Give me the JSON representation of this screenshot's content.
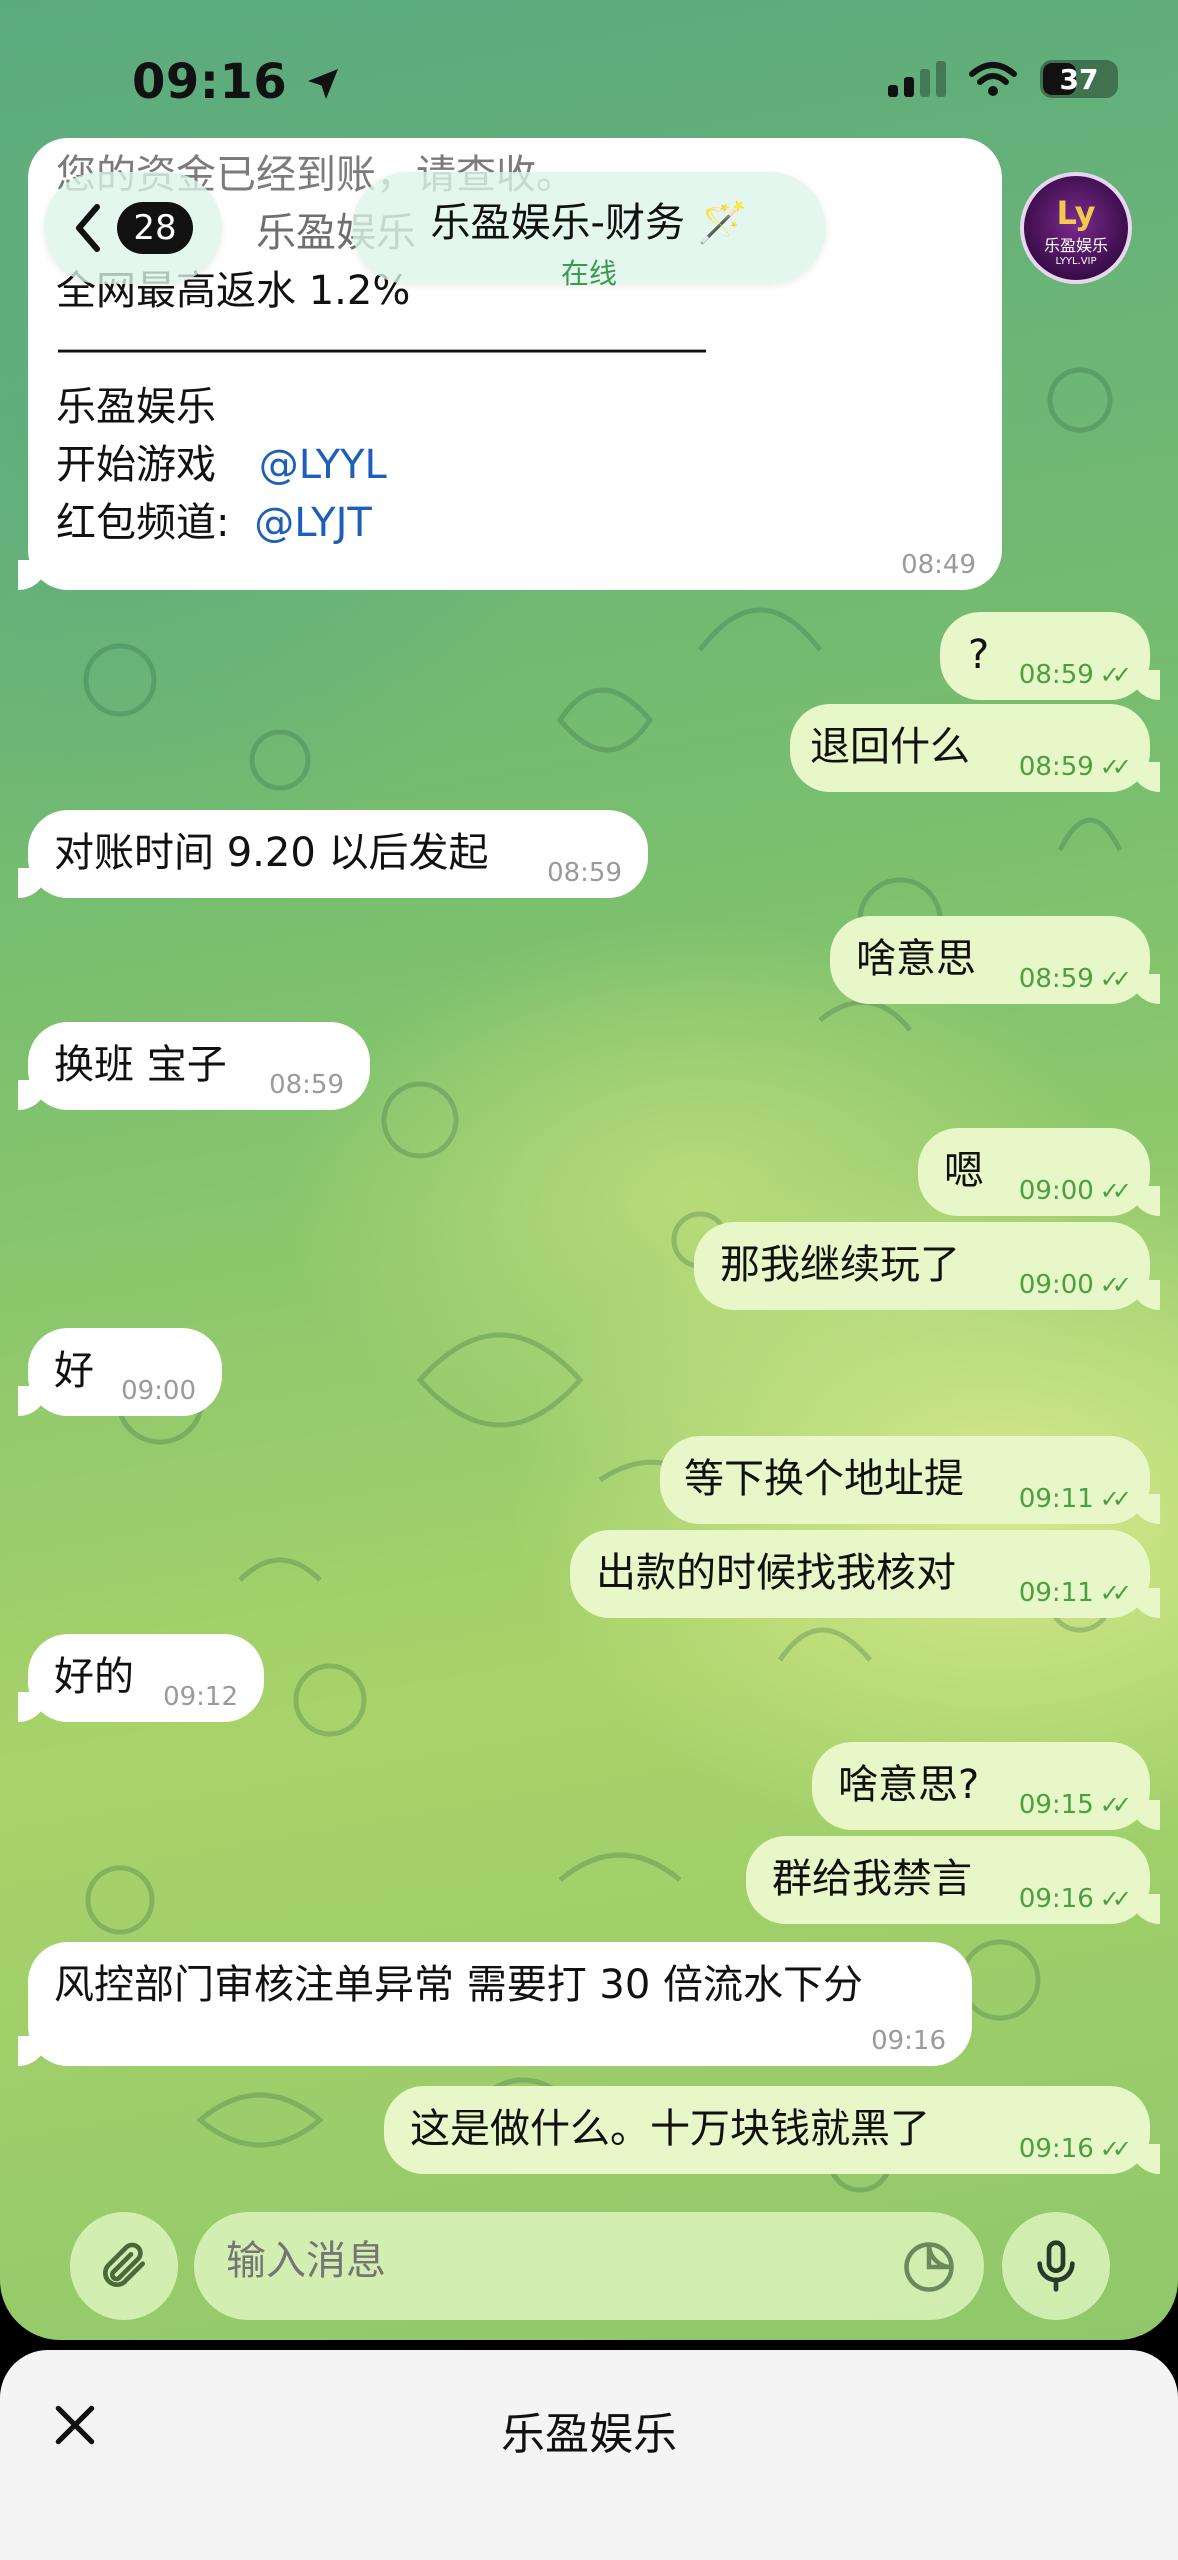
{
  "status_bar": {
    "time": "09:16",
    "battery": "37"
  },
  "header": {
    "back_count": "28",
    "title": "乐盈娱乐-财务",
    "title_emoji": "🪄",
    "subtitle": "在线",
    "avatar_logo": "Ly",
    "avatar_name": "乐盈娱乐",
    "avatar_tag": "LYYL.VIP"
  },
  "pinned_message": {
    "line_cut": "您的资金已经到账，请查收。",
    "line_partial": "乐盈娱乐",
    "line1": "全网最高返水 1.2%",
    "divider": "——————————————————",
    "line2": "乐盈娱乐",
    "line3_label": "开始游戏",
    "line3_link": "@LYYL",
    "line4_label": "红包频道:",
    "line4_link": "@LYJT",
    "time": "08:49"
  },
  "messages": [
    {
      "dir": "out",
      "text": "?",
      "time": "08:59"
    },
    {
      "dir": "out",
      "text": "退回什么",
      "time": "08:59"
    },
    {
      "dir": "in",
      "text": "对账时间 9.20 以后发起",
      "time": "08:59"
    },
    {
      "dir": "out",
      "text": "啥意思",
      "time": "08:59"
    },
    {
      "dir": "in",
      "text": "换班 宝子",
      "time": "08:59"
    },
    {
      "dir": "out",
      "text": "嗯",
      "time": "09:00"
    },
    {
      "dir": "out",
      "text": "那我继续玩了",
      "time": "09:00"
    },
    {
      "dir": "in",
      "text": "好",
      "time": "09:00"
    },
    {
      "dir": "out",
      "text": "等下换个地址提",
      "time": "09:11"
    },
    {
      "dir": "out",
      "text": "出款的时候找我核对",
      "time": "09:11"
    },
    {
      "dir": "in",
      "text": "好的",
      "time": "09:12"
    },
    {
      "dir": "out",
      "text": "啥意思?",
      "time": "09:15"
    },
    {
      "dir": "out",
      "text": "群给我禁言",
      "time": "09:16"
    },
    {
      "dir": "in",
      "text": "风控部门审核注单异常 需要打 30 倍流水下分",
      "time": "09:16"
    },
    {
      "dir": "out",
      "text": "这是做什么。十万块钱就黑了",
      "time": "09:16"
    }
  ],
  "composer": {
    "placeholder": "输入消息"
  },
  "sheet": {
    "title": "乐盈娱乐"
  },
  "icons": {
    "location": "location-arrow-icon",
    "attach": "paperclip-icon",
    "sticker": "sticker-icon",
    "mic": "microphone-icon",
    "close": "close-icon"
  },
  "colors": {
    "outgoing_bubble": "#e7f7c7",
    "incoming_bubble": "#ffffff",
    "link": "#1d5fb8",
    "online": "#3a9a4e"
  }
}
